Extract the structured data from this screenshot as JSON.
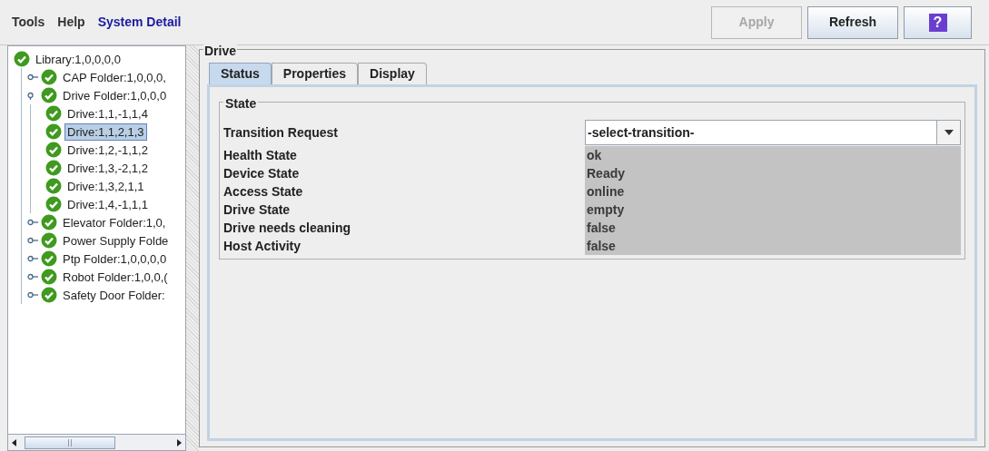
{
  "menu": [
    {
      "label": "Tools",
      "selected": false
    },
    {
      "label": "Help",
      "selected": false
    },
    {
      "label": "System Detail",
      "selected": true
    }
  ],
  "buttons": [
    {
      "kind": "text",
      "label": "Apply",
      "disabled": true
    },
    {
      "kind": "text",
      "label": "Refresh",
      "disabled": false
    },
    {
      "kind": "help",
      "label": "?",
      "disabled": false
    }
  ],
  "tree": {
    "label": "Library:1,0,0,0,0",
    "selected": false,
    "children": [
      {
        "label": "CAP Folder:1,0,0,0,",
        "expanded": false,
        "selected": false
      },
      {
        "label": "Drive Folder:1,0,0,0",
        "expanded": true,
        "selected": false,
        "children": [
          {
            "label": "Drive:1,1,-1,1,4",
            "selected": false
          },
          {
            "label": "Drive:1,1,2,1,3",
            "selected": true
          },
          {
            "label": "Drive:1,2,-1,1,2",
            "selected": false
          },
          {
            "label": "Drive:1,3,-2,1,2",
            "selected": false
          },
          {
            "label": "Drive:1,3,2,1,1",
            "selected": false
          },
          {
            "label": "Drive:1,4,-1,1,1",
            "selected": false
          }
        ]
      },
      {
        "label": "Elevator Folder:1,0,",
        "expanded": false,
        "selected": false
      },
      {
        "label": "Power Supply Folde",
        "expanded": false,
        "selected": false
      },
      {
        "label": "Ptp Folder:1,0,0,0,0",
        "expanded": false,
        "selected": false
      },
      {
        "label": "Robot Folder:1,0,0,(",
        "expanded": false,
        "selected": false
      },
      {
        "label": "Safety Door Folder:",
        "expanded": false,
        "selected": false
      }
    ]
  },
  "panel": {
    "title": "Drive",
    "tabs": [
      {
        "label": "Status",
        "selected": true
      },
      {
        "label": "Properties",
        "selected": false
      },
      {
        "label": "Display",
        "selected": false
      }
    ],
    "group": {
      "title": "State",
      "fields": [
        {
          "kind": "dropdown",
          "label": "Transition Request",
          "value": "-select-transition-"
        },
        {
          "kind": "value",
          "label": "Health State",
          "value": "ok"
        },
        {
          "kind": "value",
          "label": "Device State",
          "value": "Ready"
        },
        {
          "kind": "value",
          "label": "Access State",
          "value": "online"
        },
        {
          "kind": "value",
          "label": "Drive State",
          "value": "empty"
        },
        {
          "kind": "value",
          "label": "Drive needs cleaning",
          "value": "false"
        },
        {
          "kind": "value",
          "label": "Host Activity",
          "value": "false"
        }
      ]
    }
  }
}
